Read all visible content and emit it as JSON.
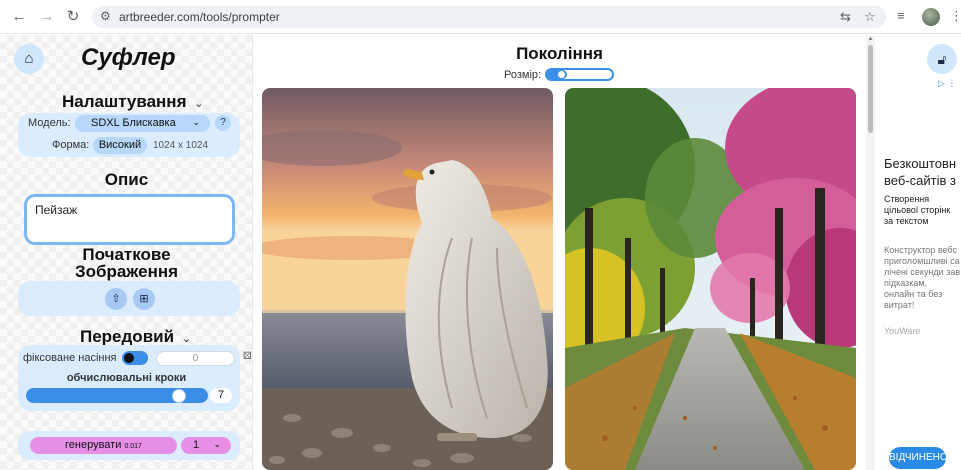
{
  "browser": {
    "url": "artbreeder.com/tools/prompter"
  },
  "app": {
    "title": "Суфлер"
  },
  "settings": {
    "title": "Налаштування",
    "model_label": "Модель:",
    "model_value": "SDXL Блискавка",
    "help": "?",
    "shape_label": "Форма:",
    "shape_value": "Високий",
    "dimensions": "1024 x 1024"
  },
  "description": {
    "title": "Опис",
    "prompt": "Пейзаж"
  },
  "initial_image": {
    "title_line1": "Початкове",
    "title_line2": "Зображення"
  },
  "advanced": {
    "title": "Передовий",
    "seed_label": "фіксоване насіння",
    "seed_value": "0",
    "steps_label": "обчислювальні кроки",
    "steps_value": "7",
    "steps_fraction": 0.87
  },
  "generate": {
    "label": "генерувати",
    "cost": "0.017",
    "count": "1"
  },
  "main": {
    "title": "Покоління",
    "size_label": "Розмір:"
  },
  "ad": {
    "title_line1": "Безкоштовн",
    "title_line2": "веб-сайтів з",
    "sub_line1": "Створення",
    "sub_line2": "цільової сторінк",
    "sub_line3": "за текстом",
    "body_line1": "Конструктор вебс",
    "body_line2": "приголомшливі са",
    "body_line3": "лічені секунди зав",
    "body_line4": "підказкам,",
    "body_line5": "онлайн та без",
    "body_line6": "витрат!",
    "brand": "YouWare",
    "open_label": "ВІДЧИНЕНО"
  },
  "colors": {
    "accent": "#3b8ee8",
    "card": "#dcecff",
    "generate": "#e78fe6"
  }
}
